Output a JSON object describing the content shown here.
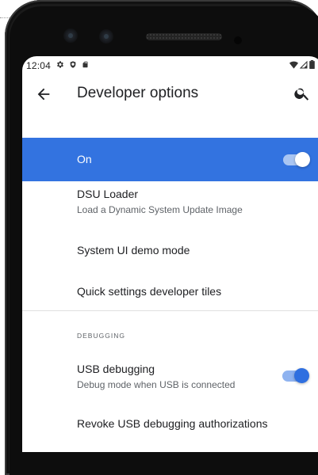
{
  "status_bar": {
    "time": "12:04",
    "left_icons": [
      "gear-icon",
      "shield-icon",
      "sd-card-icon"
    ],
    "right_icons": [
      "wifi-icon",
      "signal-icon",
      "battery-icon"
    ]
  },
  "app_bar": {
    "title": "Developer options",
    "back_icon": "back-arrow-icon",
    "search_icon": "search-icon"
  },
  "master_switch": {
    "label": "On",
    "state": true,
    "background": "#3373e0"
  },
  "items": [
    {
      "title": "DSU Loader",
      "subtitle": "Load a Dynamic System Update Image"
    },
    {
      "title": "System UI demo mode"
    },
    {
      "title": "Quick settings developer tiles"
    }
  ],
  "debugging": {
    "header": "DEBUGGING",
    "usb_debugging": {
      "title": "USB debugging",
      "subtitle": "Debug mode when USB is connected",
      "state": true
    },
    "revoke": {
      "title": "Revoke USB debugging authorizations"
    }
  },
  "colors": {
    "accent": "#2f6fe0",
    "text_primary": "#202124",
    "text_secondary": "#5f6368"
  }
}
